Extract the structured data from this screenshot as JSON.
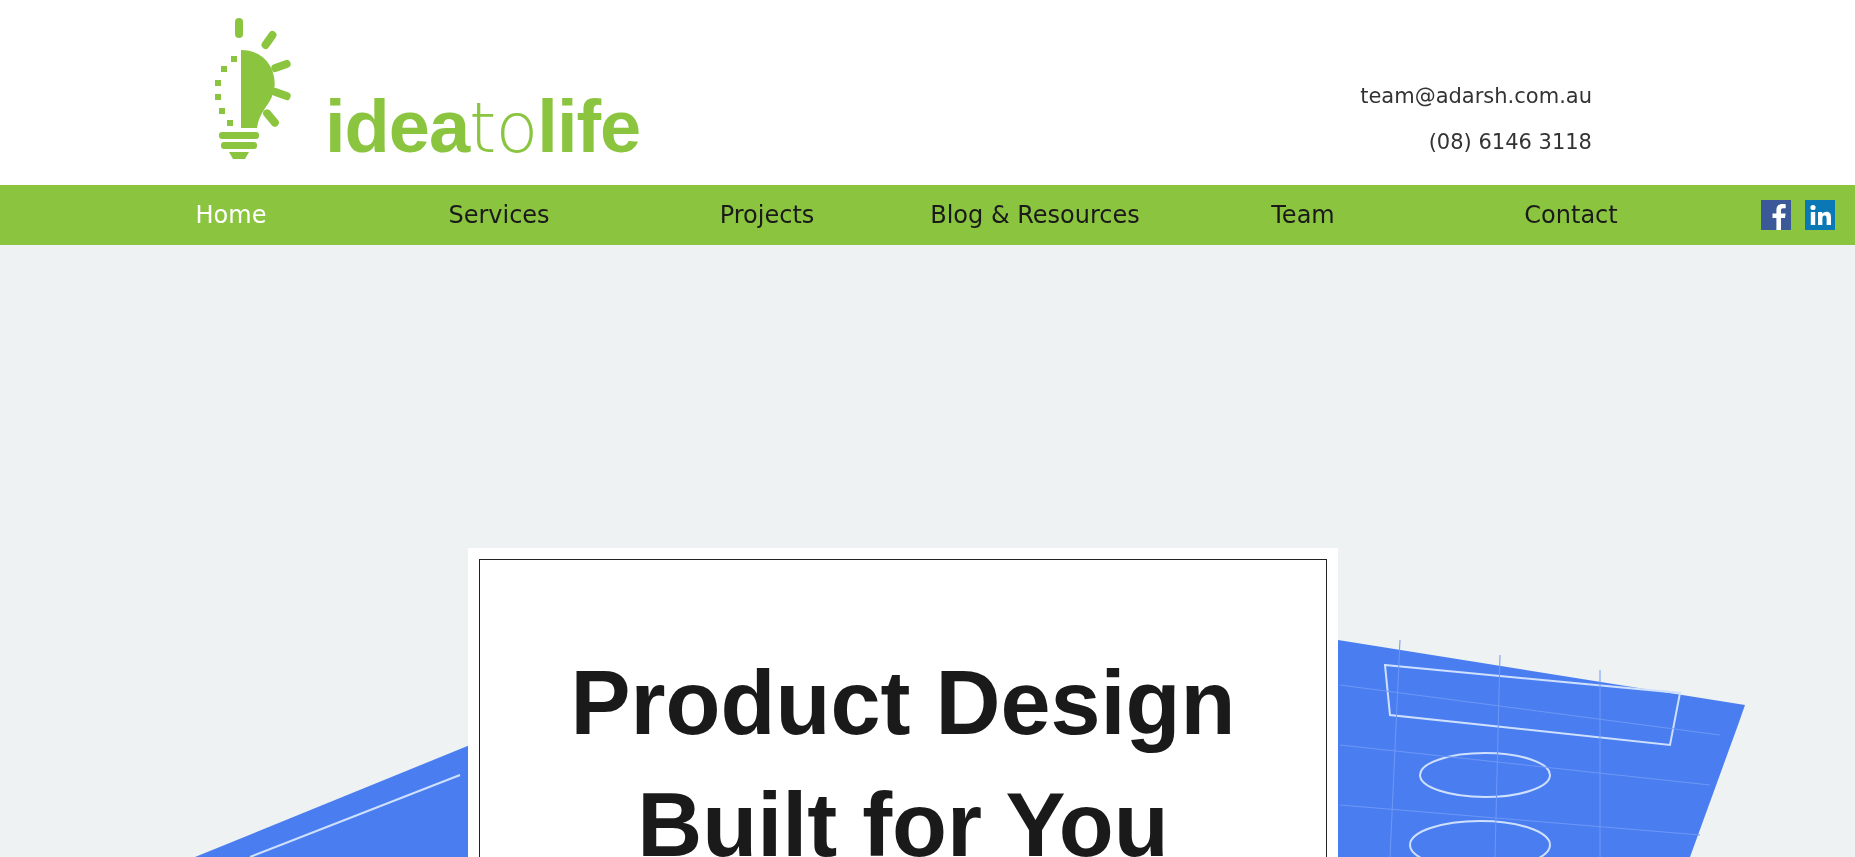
{
  "logo": {
    "parts": [
      {
        "text": "idea",
        "kind": "bold"
      },
      {
        "text": "to",
        "kind": "thin"
      },
      {
        "text": "life",
        "kind": "bold"
      }
    ]
  },
  "contact": {
    "email": "team@adarsh.com.au",
    "phone": "(08) 6146 3118"
  },
  "nav": [
    {
      "label": "Home",
      "selected": true
    },
    {
      "label": "Services",
      "selected": false
    },
    {
      "label": "Projects",
      "selected": false
    },
    {
      "label": "Blog & Resources",
      "selected": false
    },
    {
      "label": "Team",
      "selected": false
    },
    {
      "label": "Contact",
      "selected": false
    }
  ],
  "social": [
    {
      "kind": "facebook"
    },
    {
      "kind": "linkedin"
    }
  ],
  "hero": {
    "title_lines": [
      "Product Design",
      "Built for You"
    ]
  }
}
